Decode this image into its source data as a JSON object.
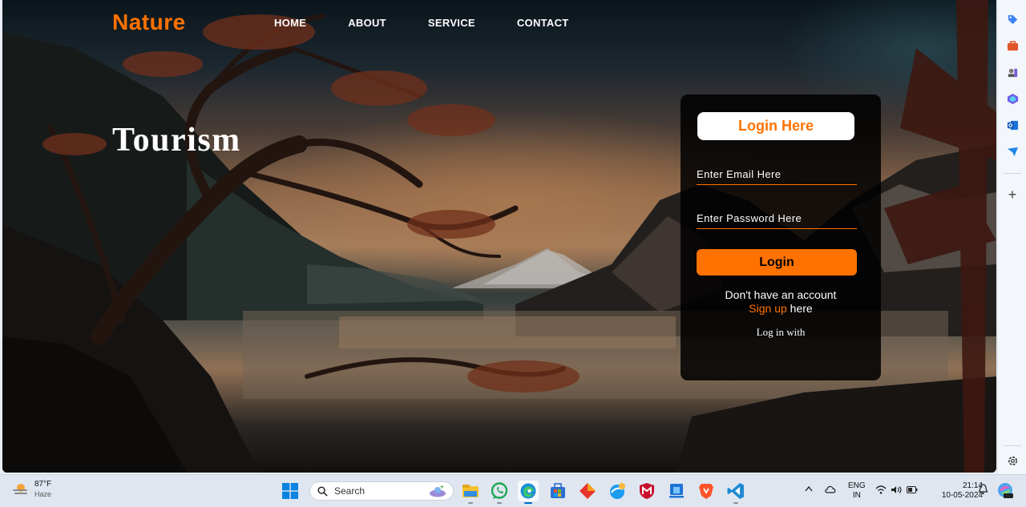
{
  "site": {
    "logo": "Nature",
    "nav": [
      "HOME",
      "ABOUT",
      "SERVICE",
      "CONTACT"
    ],
    "hero_title": "Tourism"
  },
  "login": {
    "heading": "Login Here",
    "email_placeholder": "Enter Email Here",
    "password_placeholder": "Enter Password Here",
    "button": "Login",
    "account_prompt": "Don't have an account",
    "signup_link": "Sign up",
    "signup_suffix": " here",
    "login_with": "Log in with"
  },
  "colors": {
    "accent": "#ff7200",
    "card_bg": "#000000",
    "text": "#ffffff"
  },
  "edge_sidebar": {
    "icons": [
      "tag-icon",
      "briefcase-icon",
      "chess-icon",
      "copilot-icon",
      "outlook-icon",
      "send-icon",
      "add-icon",
      "settings-icon"
    ]
  },
  "taskbar": {
    "weather_temp": "87°F",
    "weather_condition": "Haze",
    "search_label": "Search",
    "apps": [
      "file-explorer-icon",
      "whatsapp-icon",
      "edge-icon",
      "store-icon",
      "diamond-app-icon",
      "browser-icon",
      "mcafee-icon",
      "phone-link-icon",
      "brave-icon",
      "vscode-icon"
    ],
    "language_line1": "ENG",
    "language_line2": "IN",
    "time": "21:14",
    "date": "10-05-2024"
  }
}
